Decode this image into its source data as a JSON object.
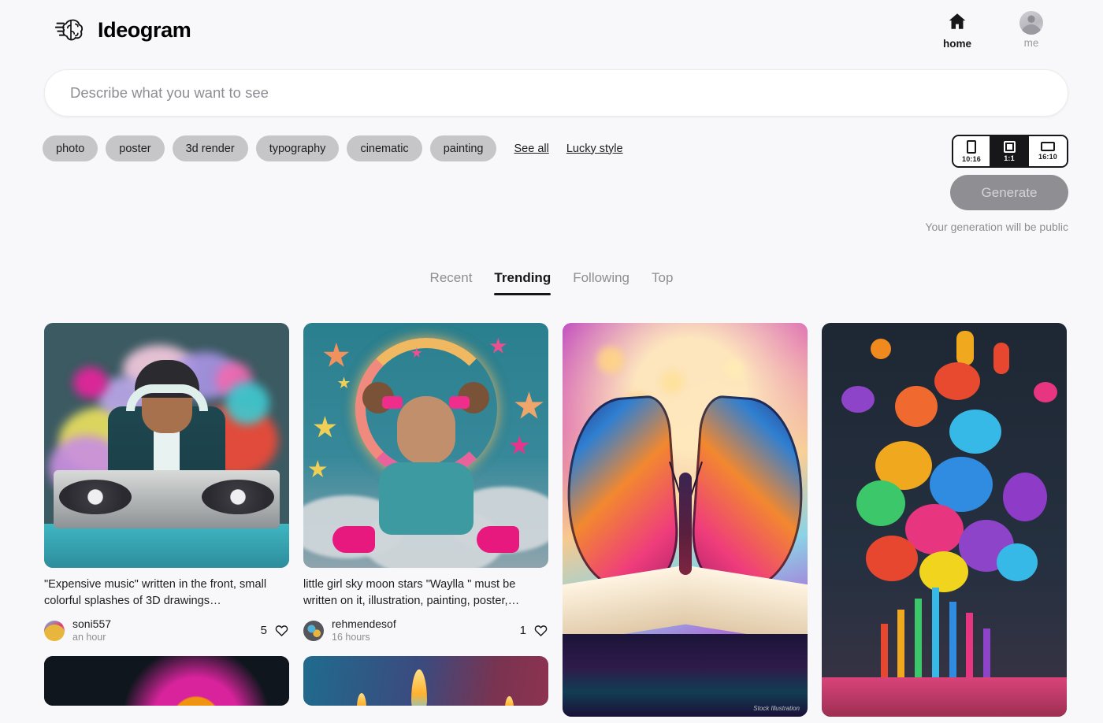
{
  "brand": {
    "name": "Ideogram",
    "logo_icon": "brain-logo-icon"
  },
  "nav": {
    "items": [
      {
        "label": "home",
        "icon": "home-icon",
        "active": true
      },
      {
        "label": "me",
        "icon": "avatar-icon",
        "active": false
      }
    ]
  },
  "search": {
    "value": "",
    "placeholder": "Describe what you want to see"
  },
  "styles": {
    "chips": [
      "photo",
      "poster",
      "3d render",
      "typography",
      "cinematic",
      "painting"
    ],
    "see_all_label": "See all",
    "lucky_style_label": "Lucky style"
  },
  "aspect_ratio": {
    "options": [
      {
        "label": "10:16",
        "shape": "portrait",
        "selected": false
      },
      {
        "label": "1:1",
        "shape": "square",
        "selected": true
      },
      {
        "label": "16:10",
        "shape": "landscape",
        "selected": false
      }
    ],
    "selected": "1:1"
  },
  "generate": {
    "label": "Generate",
    "enabled": false,
    "note": "Your generation will be public"
  },
  "feed_tabs": {
    "items": [
      "Recent",
      "Trending",
      "Following",
      "Top"
    ],
    "active": "Trending"
  },
  "gallery": {
    "cards": [
      {
        "id": "card-dj",
        "art": "dj",
        "shape": "square",
        "caption": "\"Expensive music\" written in the front, small colorful splashes of 3D drawings…",
        "user": "soni557",
        "time": "an hour",
        "likes": "5",
        "like_icon": "heart-icon"
      },
      {
        "id": "card-moon-girl",
        "art": "moon",
        "shape": "square",
        "caption": "little girl sky moon stars \"Waylla \" must be written on it, illustration, painting, poster,…",
        "user": "rehmendesof",
        "time": "16 hours",
        "likes": "1",
        "like_icon": "heart-icon"
      },
      {
        "id": "card-butterfly",
        "art": "butterfly",
        "shape": "tall",
        "caption": "",
        "user": "",
        "time": "",
        "likes": "",
        "watermark": "Stock Illustration"
      },
      {
        "id": "card-paint-explosion",
        "art": "paint",
        "shape": "tall",
        "caption": "",
        "user": "",
        "time": "",
        "likes": ""
      },
      {
        "id": "card-dark-swirl",
        "art": "dark-swirl",
        "shape": "strip",
        "caption": "",
        "user": "",
        "time": "",
        "likes": ""
      },
      {
        "id": "card-flames",
        "art": "flames",
        "shape": "strip",
        "caption": "",
        "user": "",
        "time": "",
        "likes": ""
      }
    ]
  },
  "colors": {
    "page_background": "#f8f8fa",
    "ink": "#17171a",
    "muted": "#8d8d94",
    "chip_background": "#c6c6c9",
    "generate_background": "#8e8e93"
  }
}
